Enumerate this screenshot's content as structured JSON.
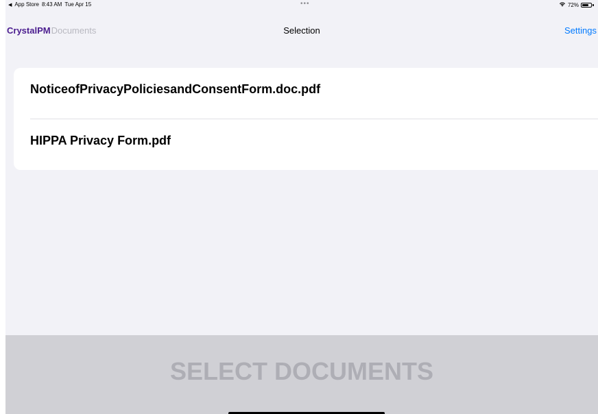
{
  "status_bar": {
    "back_app": "App Store",
    "time": "8:43 AM",
    "date": "Tue Apr 15",
    "dots": "•••",
    "battery_text": "72%",
    "battery_level": 0.72
  },
  "nav": {
    "brand_strong": "CrystalPM",
    "brand_light": "Documents",
    "title": "Selection",
    "settings_label": "Settings"
  },
  "documents": [
    {
      "label": "NoticeofPrivacyPoliciesandConsentForm.doc.pdf"
    },
    {
      "label": "HIPPA Privacy Form.pdf"
    }
  ],
  "bottom": {
    "button_label": "SELECT DOCUMENTS"
  },
  "colors": {
    "brand": "#4b1d8f",
    "accent": "#007aff",
    "background": "#f2f2f7",
    "button_bar": "#d0d0d5",
    "button_text": "#aeaeb5"
  }
}
